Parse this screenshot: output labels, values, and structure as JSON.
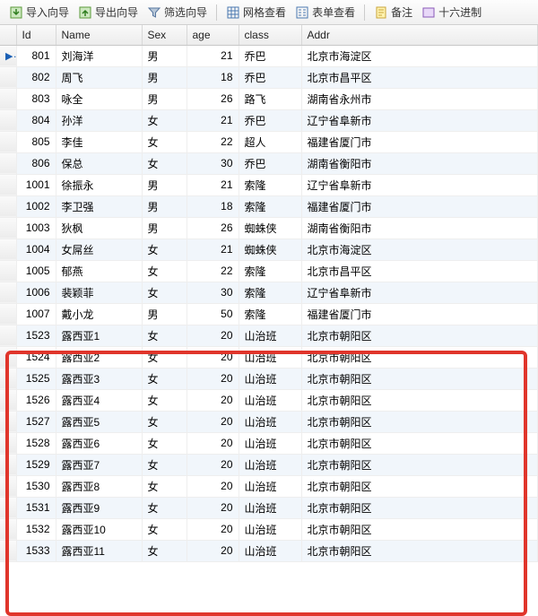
{
  "toolbar": {
    "import": "导入向导",
    "export": "导出向导",
    "filter": "筛选向导",
    "gridview": "网格查看",
    "formview": "表单查看",
    "note": "备注",
    "hex": "十六进制"
  },
  "columns": [
    "Id",
    "Name",
    "Sex",
    "age",
    "class",
    "Addr"
  ],
  "currentRow": 0,
  "highlight": {
    "fromRow": 12,
    "toRow": 23
  },
  "rows": [
    {
      "id": 801,
      "name": "刘海洋",
      "sex": "男",
      "age": 21,
      "class": "乔巴",
      "addr": "北京市海淀区"
    },
    {
      "id": 802,
      "name": "周飞",
      "sex": "男",
      "age": 18,
      "class": "乔巴",
      "addr": "北京市昌平区"
    },
    {
      "id": 803,
      "name": "咏全",
      "sex": "男",
      "age": 26,
      "class": "路飞",
      "addr": "湖南省永州市"
    },
    {
      "id": 804,
      "name": "孙洋",
      "sex": "女",
      "age": 21,
      "class": "乔巴",
      "addr": "辽宁省阜新市"
    },
    {
      "id": 805,
      "name": "李佳",
      "sex": "女",
      "age": 22,
      "class": "超人",
      "addr": "福建省厦门市"
    },
    {
      "id": 806,
      "name": "保总",
      "sex": "女",
      "age": 30,
      "class": "乔巴",
      "addr": "湖南省衡阳市"
    },
    {
      "id": 1001,
      "name": "徐振永",
      "sex": "男",
      "age": 21,
      "class": "索隆",
      "addr": "辽宁省阜新市"
    },
    {
      "id": 1002,
      "name": "李卫强",
      "sex": "男",
      "age": 18,
      "class": "索隆",
      "addr": "福建省厦门市"
    },
    {
      "id": 1003,
      "name": "狄枫",
      "sex": "男",
      "age": 26,
      "class": "蜘蛛侠",
      "addr": "湖南省衡阳市"
    },
    {
      "id": 1004,
      "name": "女屌丝",
      "sex": "女",
      "age": 21,
      "class": "蜘蛛侠",
      "addr": "北京市海淀区"
    },
    {
      "id": 1005,
      "name": "郁燕",
      "sex": "女",
      "age": 22,
      "class": "索隆",
      "addr": "北京市昌平区"
    },
    {
      "id": 1006,
      "name": "裴颖菲",
      "sex": "女",
      "age": 30,
      "class": "索隆",
      "addr": "辽宁省阜新市"
    },
    {
      "id": 1007,
      "name": "戴小龙",
      "sex": "男",
      "age": 50,
      "class": "索隆",
      "addr": "福建省厦门市"
    },
    {
      "id": 1523,
      "name": "露西亚1",
      "sex": "女",
      "age": 20,
      "class": "山治班",
      "addr": "北京市朝阳区"
    },
    {
      "id": 1524,
      "name": "露西亚2",
      "sex": "女",
      "age": 20,
      "class": "山治班",
      "addr": "北京市朝阳区"
    },
    {
      "id": 1525,
      "name": "露西亚3",
      "sex": "女",
      "age": 20,
      "class": "山治班",
      "addr": "北京市朝阳区"
    },
    {
      "id": 1526,
      "name": "露西亚4",
      "sex": "女",
      "age": 20,
      "class": "山治班",
      "addr": "北京市朝阳区"
    },
    {
      "id": 1527,
      "name": "露西亚5",
      "sex": "女",
      "age": 20,
      "class": "山治班",
      "addr": "北京市朝阳区"
    },
    {
      "id": 1528,
      "name": "露西亚6",
      "sex": "女",
      "age": 20,
      "class": "山治班",
      "addr": "北京市朝阳区"
    },
    {
      "id": 1529,
      "name": "露西亚7",
      "sex": "女",
      "age": 20,
      "class": "山治班",
      "addr": "北京市朝阳区"
    },
    {
      "id": 1530,
      "name": "露西亚8",
      "sex": "女",
      "age": 20,
      "class": "山治班",
      "addr": "北京市朝阳区"
    },
    {
      "id": 1531,
      "name": "露西亚9",
      "sex": "女",
      "age": 20,
      "class": "山治班",
      "addr": "北京市朝阳区"
    },
    {
      "id": 1532,
      "name": "露西亚10",
      "sex": "女",
      "age": 20,
      "class": "山治班",
      "addr": "北京市朝阳区"
    },
    {
      "id": 1533,
      "name": "露西亚11",
      "sex": "女",
      "age": 20,
      "class": "山治班",
      "addr": "北京市朝阳区"
    }
  ]
}
